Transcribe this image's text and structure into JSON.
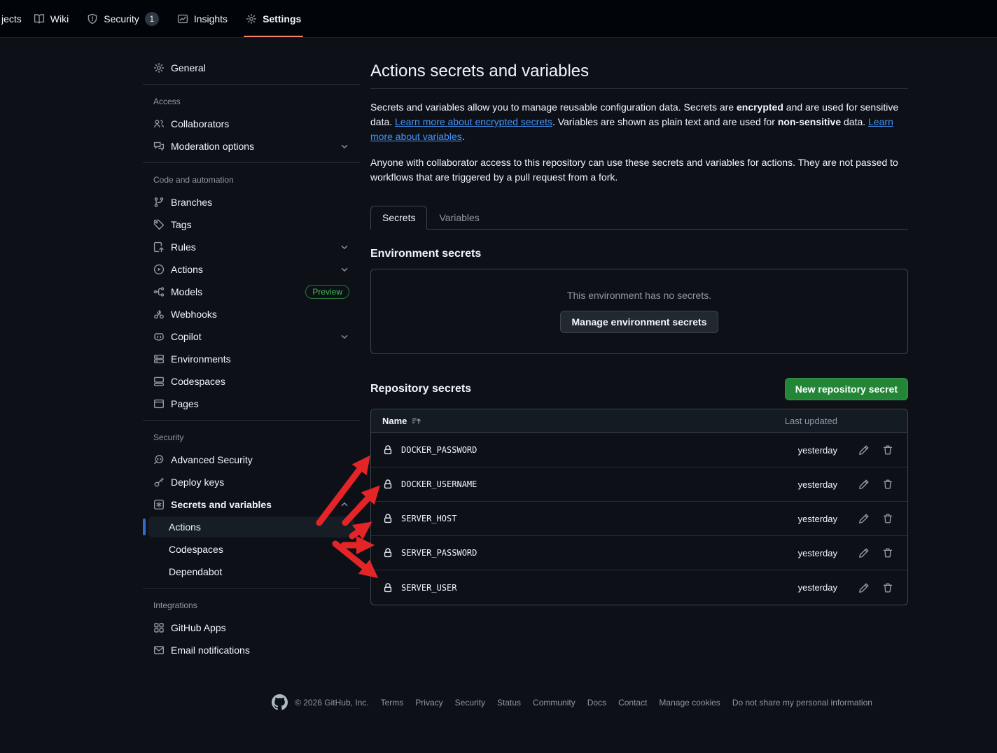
{
  "topnav": {
    "partial_tab": "jects",
    "tabs": [
      {
        "label": "Wiki"
      },
      {
        "label": "Security",
        "badge": "1"
      },
      {
        "label": "Insights"
      },
      {
        "label": "Settings"
      }
    ]
  },
  "sidebar": {
    "general_label": "General",
    "sections": [
      {
        "title": "Access"
      },
      {
        "title": "Code and automation"
      },
      {
        "title": "Security"
      },
      {
        "title": "Integrations"
      }
    ],
    "items": {
      "collaborators": "Collaborators",
      "moderation": "Moderation options",
      "branches": "Branches",
      "tags": "Tags",
      "rules": "Rules",
      "actions": "Actions",
      "models": "Models",
      "models_badge": "Preview",
      "webhooks": "Webhooks",
      "copilot": "Copilot",
      "environments": "Environments",
      "codespaces": "Codespaces",
      "pages": "Pages",
      "advanced_security": "Advanced Security",
      "deploy_keys": "Deploy keys",
      "secrets_and_variables": "Secrets and variables",
      "sub_actions": "Actions",
      "sub_codespaces": "Codespaces",
      "sub_dependabot": "Dependabot",
      "github_apps": "GitHub Apps",
      "email_notifications": "Email notifications"
    }
  },
  "main": {
    "title": "Actions secrets and variables",
    "intro": {
      "t1": "Secrets and variables allow you to manage reusable configuration data. Secrets are ",
      "b1": "encrypted",
      "t2": " and are used for sensitive data. ",
      "link1": "Learn more about encrypted secrets",
      "t3": ". Variables are shown as plain text and are used for ",
      "b2": "non-sensitive",
      "t4": " data. ",
      "link2": "Learn more about variables",
      "t5": "."
    },
    "para2": "Anyone with collaborator access to this repository can use these secrets and variables for actions. They are not passed to workflows that are triggered by a pull request from a fork.",
    "tabs": {
      "secrets": "Secrets",
      "variables": "Variables"
    },
    "environment": {
      "heading": "Environment secrets",
      "empty_message": "This environment has no secrets.",
      "manage_button": "Manage environment secrets"
    },
    "repository": {
      "heading": "Repository secrets",
      "new_button": "New repository secret",
      "col_name": "Name",
      "col_updated": "Last updated",
      "rows": [
        {
          "name": "DOCKER_PASSWORD",
          "updated": "yesterday"
        },
        {
          "name": "DOCKER_USERNAME",
          "updated": "yesterday"
        },
        {
          "name": "SERVER_HOST",
          "updated": "yesterday"
        },
        {
          "name": "SERVER_PASSWORD",
          "updated": "yesterday"
        },
        {
          "name": "SERVER_USER",
          "updated": "yesterday"
        }
      ]
    }
  },
  "footer": {
    "copyright": "© 2026 GitHub, Inc.",
    "links": [
      "Terms",
      "Privacy",
      "Security",
      "Status",
      "Community",
      "Docs",
      "Contact",
      "Manage cookies",
      "Do not share my personal information"
    ]
  },
  "colors": {
    "accent_underline": "#f78166",
    "selected_marker": "#316dca",
    "primary_button": "#238636",
    "preview_badge": "#3fb950",
    "link": "#4493f8",
    "annotation_arrow": "#e42528"
  }
}
